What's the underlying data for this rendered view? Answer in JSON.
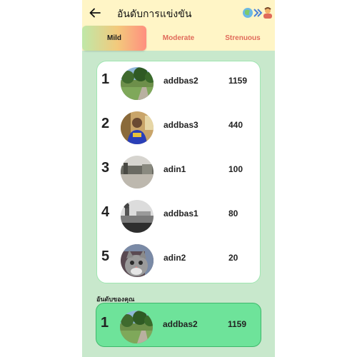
{
  "header": {
    "title": "อันดับการแข่งขัน",
    "back_icon": "arrow-left-icon",
    "logo_icon": "app-logo-icon"
  },
  "tabs": [
    {
      "label": "Mild",
      "active": true
    },
    {
      "label": "Moderate",
      "active": false
    },
    {
      "label": "Strenuous",
      "active": false
    }
  ],
  "leaderboard": [
    {
      "rank": "1",
      "name": "addbas2",
      "score": "1159",
      "avatar": "park-photo"
    },
    {
      "rank": "2",
      "name": "addbas3",
      "score": "440",
      "avatar": "person-photo"
    },
    {
      "rank": "3",
      "name": "adin1",
      "score": "100",
      "avatar": "street-photo"
    },
    {
      "rank": "4",
      "name": "addbas1",
      "score": "80",
      "avatar": "building-photo"
    },
    {
      "rank": "5",
      "name": "adin2",
      "score": "20",
      "avatar": "cat-photo"
    }
  ],
  "my_rank": {
    "label": "อันดับของคุณ",
    "rank": "1",
    "name": "addbas2",
    "score": "1159",
    "avatar": "park-photo"
  },
  "colors": {
    "appbar": "#fff5c6",
    "background": "#c8e8cc",
    "tab_inactive": "#e06a5a",
    "my_card": "#6ee39a"
  }
}
